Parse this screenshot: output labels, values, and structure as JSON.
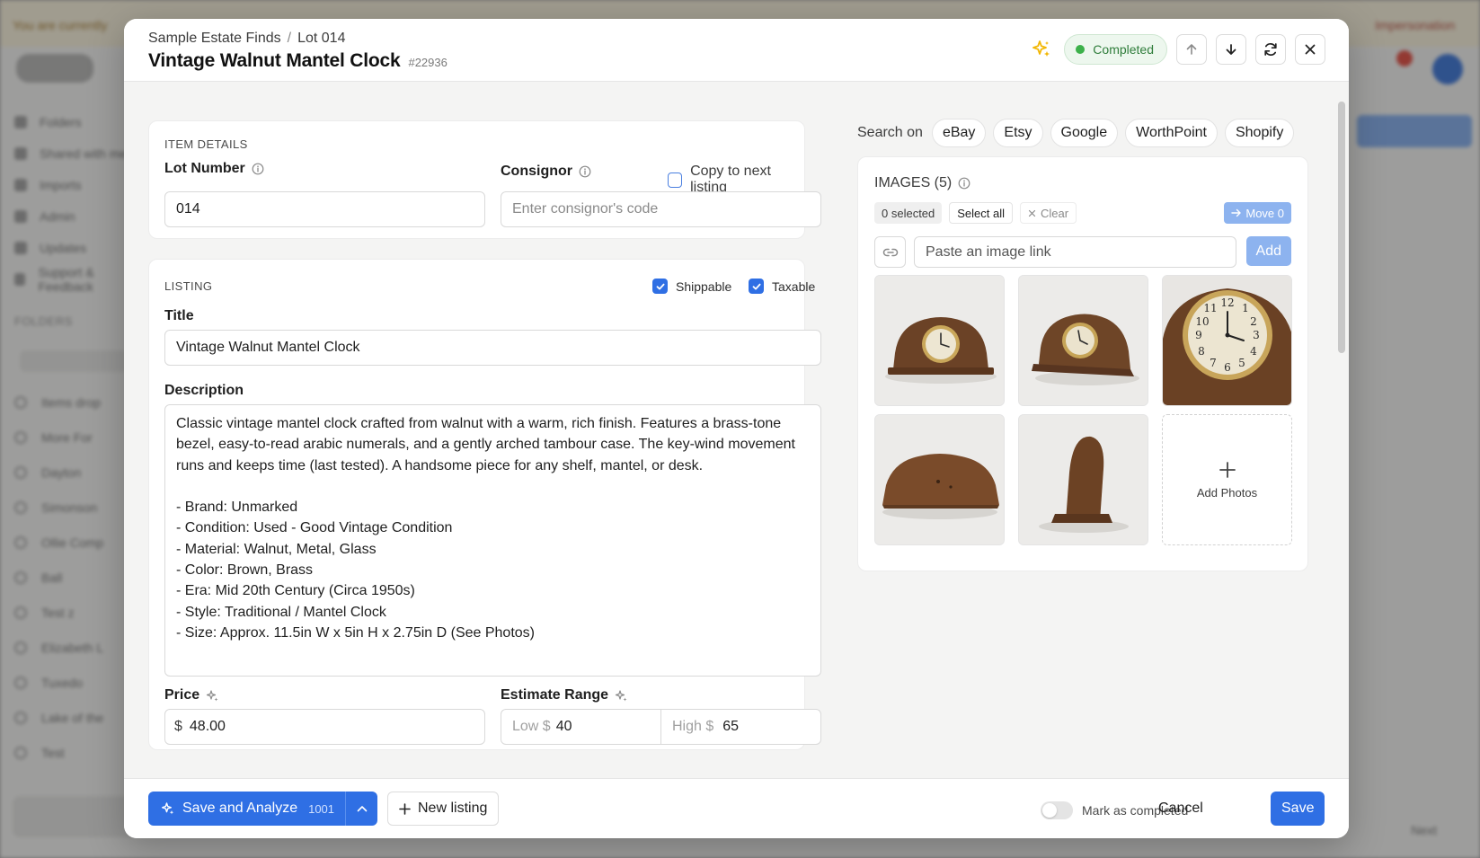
{
  "background": {
    "banner_left": "You are currently",
    "banner_right": "Impersonation",
    "nav": [
      "Folders",
      "Shared with me",
      "Imports",
      "Admin",
      "Updates",
      "Support & Feedback"
    ],
    "folders_title": "FOLDERS",
    "folders": [
      "Items drop",
      "More For",
      "Dayton",
      "Simonson",
      "Ollie Comp",
      "Ball",
      "Test z",
      "Elizabeth L",
      "Tuxedo",
      "Lake of the",
      "Test"
    ],
    "next_label": "Next"
  },
  "header": {
    "breadcrumb": [
      "Sample Estate Finds",
      "Lot 014"
    ],
    "title": "Vintage Walnut Mantel Clock",
    "item_id": "#22936",
    "status": "Completed",
    "icons": [
      "sparkle-icon",
      "arrow-up-icon",
      "arrow-down-icon",
      "refresh-icon",
      "close-icon"
    ]
  },
  "item_details": {
    "section_label": "ITEM DETAILS",
    "lot_number_label": "Lot Number",
    "lot_number_value": "014",
    "consignor_label": "Consignor",
    "consignor_placeholder": "Enter consignor's code",
    "copy_next_label": "Copy to next listing",
    "copy_next_checked": false
  },
  "listing": {
    "section_label": "LISTING",
    "shippable_label": "Shippable",
    "shippable_checked": true,
    "taxable_label": "Taxable",
    "taxable_checked": true,
    "title_label": "Title",
    "title_value": "Vintage Walnut Mantel Clock",
    "description_label": "Description",
    "description_value": "Classic vintage mantel clock crafted from walnut with a warm, rich finish. Features a brass-tone bezel, easy-to-read arabic numerals, and a gently arched tambour case. The key-wind movement runs and keeps time (last tested). A handsome piece for any shelf, mantel, or desk.\n\n- Brand: Unmarked\n- Condition: Used - Good Vintage Condition\n- Material: Walnut, Metal, Glass\n- Color: Brown, Brass\n- Era: Mid 20th Century (Circa 1950s)\n- Style: Traditional / Mantel Clock\n- Size: Approx. 11.5in W x 5in H x 2.75in D (See Photos)",
    "price_label": "Price",
    "price_currency": "$",
    "price_value": "48.00",
    "estimate_label": "Estimate Range",
    "estimate_low_prefix": "Low $",
    "estimate_low": "40",
    "estimate_high_prefix": "High $",
    "estimate_high": "65"
  },
  "search_on": {
    "label": "Search on",
    "sites": [
      "eBay",
      "Etsy",
      "Google",
      "WorthPoint",
      "Shopify"
    ]
  },
  "images": {
    "title": "IMAGES (5)",
    "selected_label": "0 selected",
    "select_all_label": "Select all",
    "clear_label": "Clear",
    "move_label": "Move 0",
    "link_placeholder": "Paste an image link",
    "add_label": "Add",
    "add_photos_label": "Add Photos",
    "thumbnails": [
      "clock-front-left",
      "clock-front-right",
      "clock-face-closeup",
      "clock-back",
      "clock-side"
    ]
  },
  "footer": {
    "save_analyze_label": "Save and Analyze",
    "save_analyze_count": "1001",
    "new_listing_label": "New listing",
    "mark_completed_label": "Mark as completed",
    "mark_completed_on": false,
    "cancel_label": "Cancel",
    "save_label": "Save"
  },
  "colors": {
    "primary": "#2f6fe4",
    "status_green": "#3cb14a",
    "sparkle": "#f2b705"
  }
}
